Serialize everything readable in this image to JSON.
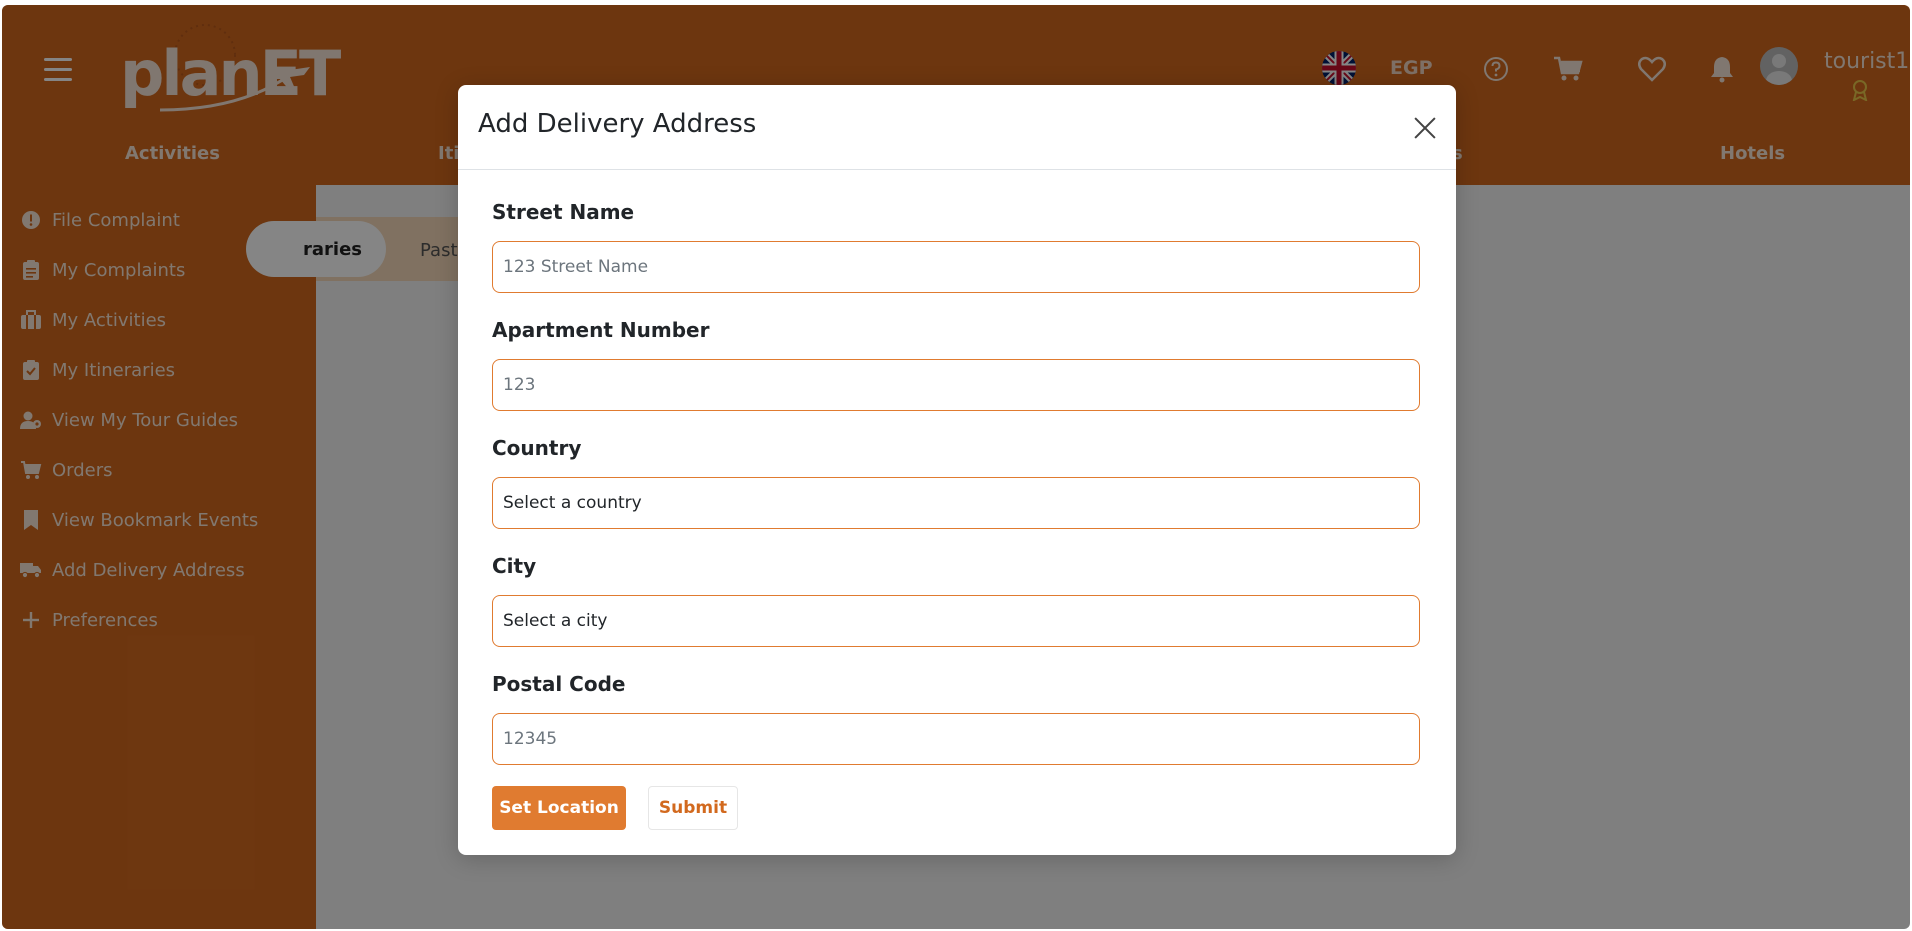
{
  "header": {
    "logo_text": "planET",
    "currency": "EGP",
    "username": "tourist1",
    "icons": [
      "menu-icon",
      "uk-flag-icon",
      "help-icon",
      "cart-icon",
      "heart-icon",
      "bell-icon",
      "user-avatar-icon",
      "badge-icon"
    ]
  },
  "nav": {
    "items": [
      {
        "label": "Activities"
      },
      {
        "label": "Iti"
      },
      {
        "label": "s"
      },
      {
        "label": "Hotels"
      }
    ]
  },
  "sidebar": {
    "items": [
      {
        "label": "File Complaint",
        "icon": "alert-circle-icon"
      },
      {
        "label": "My Complaints",
        "icon": "clipboard-icon"
      },
      {
        "label": "My Activities",
        "icon": "luggage-icon"
      },
      {
        "label": "My Itineraries",
        "icon": "checklist-icon"
      },
      {
        "label": "View My Tour Guides",
        "icon": "user-guide-icon"
      },
      {
        "label": "Orders",
        "icon": "cart-icon"
      },
      {
        "label": "View Bookmark Events",
        "icon": "bookmark-icon"
      },
      {
        "label": "Add Delivery Address",
        "icon": "truck-icon"
      },
      {
        "label": "Preferences",
        "icon": "plus-icon"
      }
    ]
  },
  "main": {
    "tab_active": "raries",
    "tab_past": "Past"
  },
  "modal": {
    "title": "Add Delivery Address",
    "fields": [
      {
        "label": "Street Name",
        "placeholder": "123 Street Name"
      },
      {
        "label": "Apartment Number",
        "placeholder": "123"
      },
      {
        "label": "Country",
        "value": "Select a country"
      },
      {
        "label": "City",
        "value": "Select a city"
      },
      {
        "label": "Postal Code",
        "placeholder": "12345"
      }
    ],
    "set_location_label": "Set Location",
    "submit_label": "Submit"
  },
  "colors": {
    "brand": "#d2691e",
    "accent": "#e07b30"
  }
}
